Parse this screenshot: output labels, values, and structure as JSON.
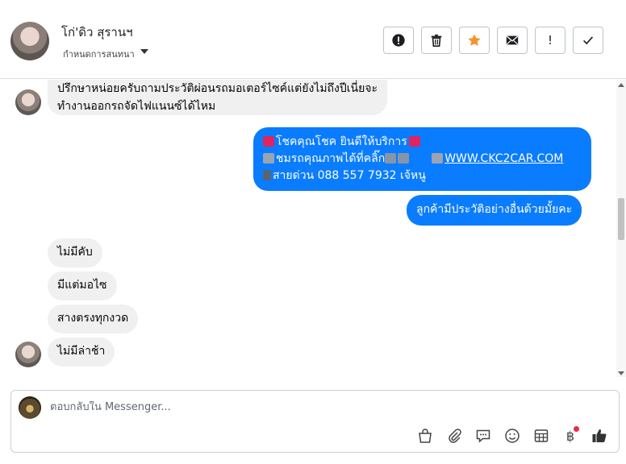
{
  "header": {
    "contact_name": "โก่'ดิว สุรานฯ",
    "assign_label": "กำหนดการสนทนา",
    "actions": [
      {
        "name": "spam-button",
        "icon": "alert-circle-icon"
      },
      {
        "name": "delete-button",
        "icon": "trash-icon"
      },
      {
        "name": "star-button",
        "icon": "star-icon",
        "color": "#f5922f"
      },
      {
        "name": "mark-unread-button",
        "icon": "envelope-icon"
      },
      {
        "name": "follow-up-button",
        "icon": "exclamation-icon",
        "glyph": "!"
      },
      {
        "name": "mark-done-button",
        "icon": "check-icon"
      }
    ]
  },
  "messages": {
    "incoming_top": {
      "line1": "ปรึกษาหน่อยครับถามประวัติผ่อนรถมอเตอร์ไซค์แต่ยังไม่ถึงปีเนี่ยจะ",
      "line2": "ทำงานออกรถจัดไฟแนนซ์ได้ไหม"
    },
    "outgoing_promo": {
      "line1": "โชคคุณโชค ยินดีให้บริการ",
      "line2_text": "ชมรถคุณภาพได้ที่คลิ๊ก",
      "line2_link": "WWW.CKC2CAR.COM",
      "line3": "สายด่วน 088 557 7932 เจ้หนู"
    },
    "outgoing_question": "ลูกค้ามีประวัติอย่างอื่นด้วยมั้ยคะ",
    "incoming_replies": [
      "ไม่มีคับ",
      "มีแต่มอไซ",
      "สางตรงทุกงวด",
      "ไม่มีล่าช้า"
    ]
  },
  "composer": {
    "placeholder": "ตอบกลับใน Messenger...",
    "tools": [
      "bag-icon",
      "paperclip-icon",
      "saved-reply-icon",
      "emoji-icon",
      "table-icon",
      "baht-icon",
      "like-icon"
    ],
    "baht_glyph": "฿"
  },
  "colors": {
    "outgoing_bubble": "#0a7cff",
    "incoming_bubble": "#f0f0f0",
    "star": "#f5922f",
    "notification_dot": "#f02849"
  }
}
